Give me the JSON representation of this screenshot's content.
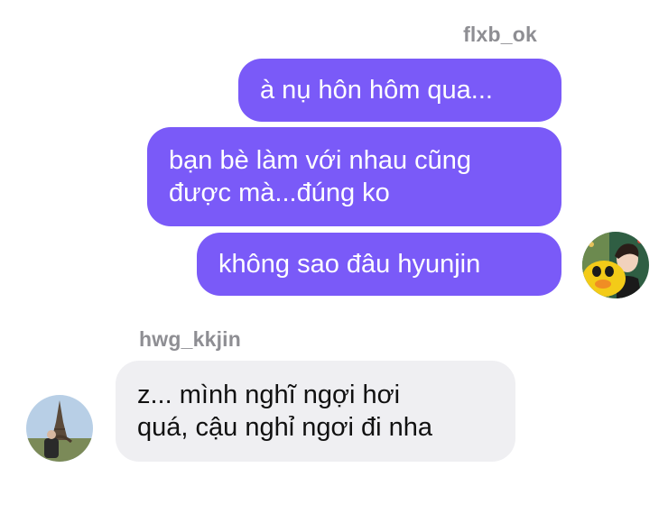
{
  "conversation": {
    "outgoing": {
      "sender": "flxb_ok",
      "messages": [
        "à nụ hôn hôm qua...",
        "bạn bè làm với nhau cũng\nđược mà...đúng ko",
        "không sao đâu hyunjin"
      ]
    },
    "incoming": {
      "sender": "hwg_kkjin",
      "messages": [
        "z... mình nghĩ ngợi hơi\nquá, cậu nghỉ ngơi đi nha"
      ]
    }
  },
  "colors": {
    "outgoing_bubble": "#7A5AF8",
    "incoming_bubble": "#EFEFF2",
    "sender_name": "#8e8e93"
  },
  "avatars": {
    "outgoing": "avatar-with-yellow-duck-plush",
    "incoming": "avatar-eiffel-tower-photo"
  }
}
